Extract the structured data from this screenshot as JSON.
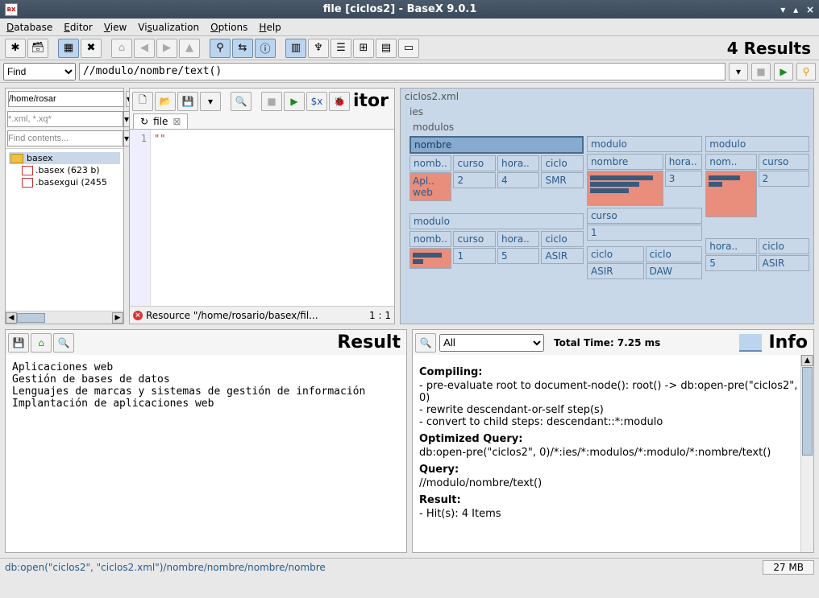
{
  "title": "file [ciclos2] - BaseX 9.0.1",
  "menu": {
    "database": "Database",
    "editor": "Editor",
    "view": "View",
    "visualization": "Visualization",
    "options": "Options",
    "help": "Help"
  },
  "toolbar_results": "4 Results",
  "querybar": {
    "mode": "Find",
    "query": "//modulo/nombre/text()"
  },
  "left": {
    "path": "/home/rosar",
    "filter": "*.xml, *.xq*",
    "find": "Find contents...",
    "folder": "basex",
    "file1": ".basex (623 b)",
    "file2": ".basexgui (2455"
  },
  "editor": {
    "title_suffix": "itor",
    "tab": "file",
    "line": "1",
    "code": "\"\"",
    "error": "Resource \"/home/rosario/basex/fil...",
    "pos": "1 : 1"
  },
  "viz": {
    "root": "ciclos2.xml",
    "ies": "ies",
    "modulos": "modulos",
    "nombre": "nombre",
    "modulo": "modulo",
    "curso": "curso",
    "hora": "hora..",
    "ciclo": "ciclo",
    "nomb": "nomb..",
    "nomc": "nom..",
    "apl": "Apl..",
    "web": " web",
    "v2": "2",
    "v4": "4",
    "smr": "SMR",
    "v3": "3",
    "v1": "1",
    "v5": "5",
    "asir": "ASIR",
    "daw": "DAW"
  },
  "result": {
    "title": "Result",
    "body": "Aplicaciones web\nGestión de bases de datos\nLenguajes de marcas y sistemas de gestión de información\nImplantación de aplicaciones web"
  },
  "info": {
    "title": "Info",
    "filter": "All",
    "timing": "Total Time: 7.25 ms",
    "h1": "Compiling:",
    "c1": "- pre-evaluate root to document-node(): root() -> db:open-pre(\"ciclos2\", 0)",
    "c2": "- rewrite descendant-or-self step(s)",
    "c3": "- convert to child steps: descendant::*:modulo",
    "h2": "Optimized Query:",
    "oq": "db:open-pre(\"ciclos2\", 0)/*:ies/*:modulos/*:modulo/*:nombre/text()",
    "h3": "Query:",
    "q": "//modulo/nombre/text()",
    "h4": "Result:",
    "r": "- Hit(s): 4 Items"
  },
  "status": {
    "path": "db:open(\"ciclos2\", \"ciclos2.xml\")/nombre/nombre/nombre/nombre",
    "mem": "27 MB"
  }
}
